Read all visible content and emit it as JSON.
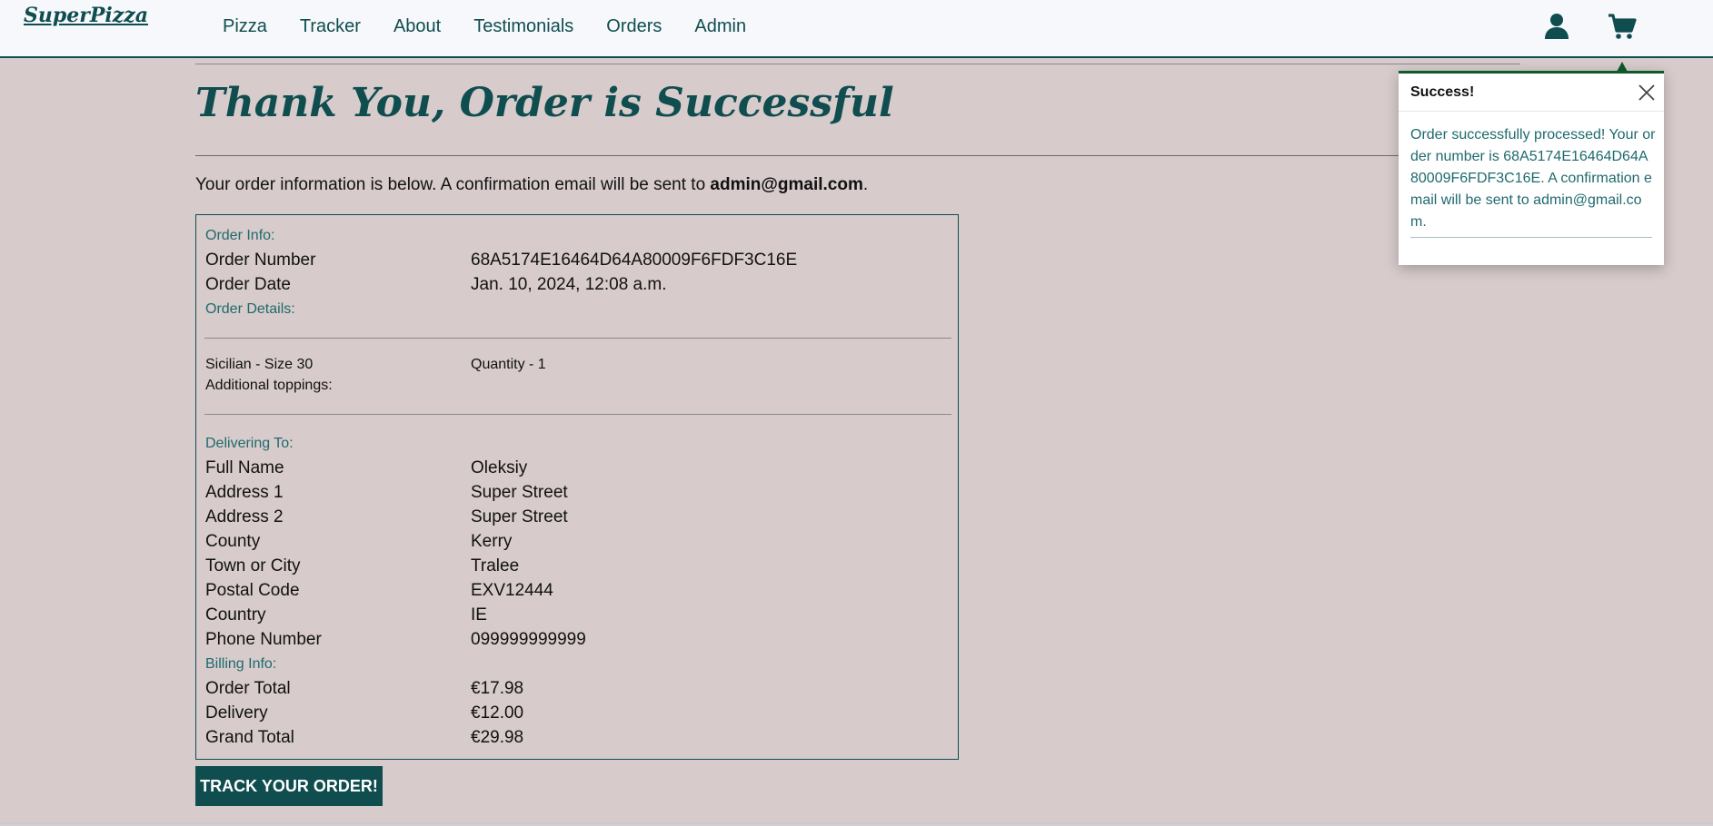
{
  "nav": {
    "brand": "SuperPizza",
    "links": [
      "Pizza",
      "Tracker",
      "About",
      "Testimonials",
      "Orders",
      "Admin"
    ],
    "icons": [
      "user-icon",
      "cart-icon"
    ]
  },
  "page": {
    "title": "Thank You, Order is Successful",
    "intro_prefix": "Your order information is below. A confirmation email will be sent to ",
    "intro_email": "admin@gmail.com",
    "intro_suffix": "."
  },
  "order_info": {
    "heading": "Order Info:",
    "number_label": "Order Number",
    "number_value": "68A5174E16464D64A80009F6FDF3C16E",
    "date_label": "Order Date",
    "date_value": "Jan. 10, 2024, 12:08 a.m."
  },
  "order_details": {
    "heading": "Order Details:",
    "item_name": "Sicilian - Size 30",
    "item_quantity": "Quantity - 1",
    "toppings_label": "Additional toppings:"
  },
  "delivery": {
    "heading": "Delivering To:",
    "rows": [
      {
        "label": "Full Name",
        "value": "Oleksiy"
      },
      {
        "label": "Address 1",
        "value": "Super Street"
      },
      {
        "label": "Address 2",
        "value": "Super Street"
      },
      {
        "label": "County",
        "value": "Kerry"
      },
      {
        "label": "Town or City",
        "value": "Tralee"
      },
      {
        "label": "Postal Code",
        "value": "EXV12444"
      },
      {
        "label": "Country",
        "value": "IE"
      },
      {
        "label": "Phone Number",
        "value": "099999999999"
      }
    ]
  },
  "billing": {
    "heading": "Billing Info:",
    "rows": [
      {
        "label": "Order Total",
        "value": "€17.98"
      },
      {
        "label": "Delivery",
        "value": "€12.00"
      },
      {
        "label": "Grand Total",
        "value": "€29.98"
      }
    ]
  },
  "track_button": "TRACK YOUR ORDER!",
  "toast": {
    "title": "Success!",
    "message": "Order successfully processed! Your order number is 68A5174E16464D64A80009F6FDF3C16E. A confirmation email will be sent to admin@gmail.com.",
    "accent": "#0d5a2a"
  },
  "colors": {
    "brand": "#0f4d4f",
    "background": "#d7cbcb",
    "navbar": "#f6f8fb"
  }
}
